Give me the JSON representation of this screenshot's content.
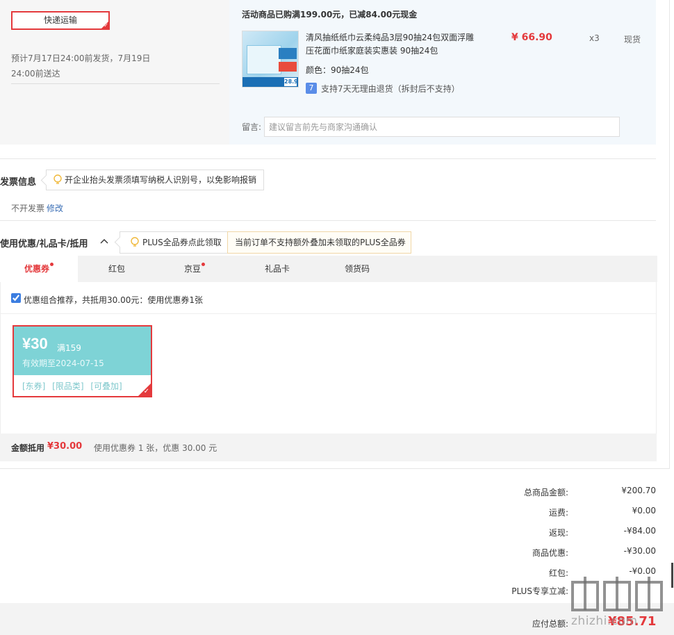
{
  "shipping": {
    "method_label": "快递运输",
    "delivery_estimate": "预计7月17日24:00前发货，7月19日24:00前送达"
  },
  "order_item": {
    "promo_text": "活动商品已购满199.00元，已减84.00元现金",
    "title": "清风抽纸纸巾云柔纯品3层90抽24包双面浮雕压花面巾纸家庭装实惠装 90抽24包",
    "price": "¥ 66.90",
    "quantity": "x3",
    "stock": "现货",
    "color_label": "颜色：",
    "color_value": "90抽24包",
    "return_icon": "7",
    "return_policy": "支持7天无理由退货（拆封后不支持）",
    "memo_label": "留言:",
    "memo_placeholder": "建议留言前先与商家沟通确认",
    "memo_value": "",
    "thumbnail_price": "28.9"
  },
  "invoice": {
    "title": "发票信息",
    "tip": "开企业抬头发票须填写纳税人识别号，以免影响报销",
    "status": "不开发票",
    "edit_label": "修改"
  },
  "coupons": {
    "title": "使用优惠/礼品卡/抵用",
    "plus_tip": "PLUS全品券点此领取",
    "plus_warning": "当前订单不支持额外叠加未领取的PLUS全品券",
    "tabs": [
      {
        "label": "优惠券",
        "active": true,
        "dot": true
      },
      {
        "label": "红包",
        "active": false,
        "dot": false
      },
      {
        "label": "京豆",
        "active": false,
        "dot": true
      },
      {
        "label": "礼品卡",
        "active": false,
        "dot": false
      },
      {
        "label": "领货码",
        "active": false,
        "dot": false
      }
    ],
    "combo_checked": true,
    "combo_text": "优惠组合推荐，共抵用30.00元：使用优惠券1张",
    "coupon": {
      "amount": "¥30",
      "condition": "满159",
      "valid": "有效期至2024-07-15",
      "tags": "[东券]  [限品类]  [可叠加]"
    },
    "summary_label": "金额抵用",
    "summary_amount": "¥30.00",
    "summary_desc": "使用优惠券 1 张，优惠 30.00 元"
  },
  "totals": {
    "rows": [
      {
        "label": "总商品金额:",
        "value": "¥200.70"
      },
      {
        "label": "运费:",
        "value": "¥0.00"
      },
      {
        "label": "返现:",
        "value": "-¥84.00"
      },
      {
        "label": "商品优惠:",
        "value": "-¥30.00"
      },
      {
        "label": "红包:",
        "value": "-¥0.00"
      },
      {
        "label": "PLUS专享立减:",
        "value": ""
      }
    ],
    "final_label": "应付总额:",
    "final_value": "¥85.71"
  },
  "watermark": "zhizhi.com",
  "colors": {
    "accent_red": "#e4393c",
    "coupon_teal": "#7ed3d6",
    "link_blue": "#3b6fb6",
    "product_bg": "#f3f8fc"
  }
}
